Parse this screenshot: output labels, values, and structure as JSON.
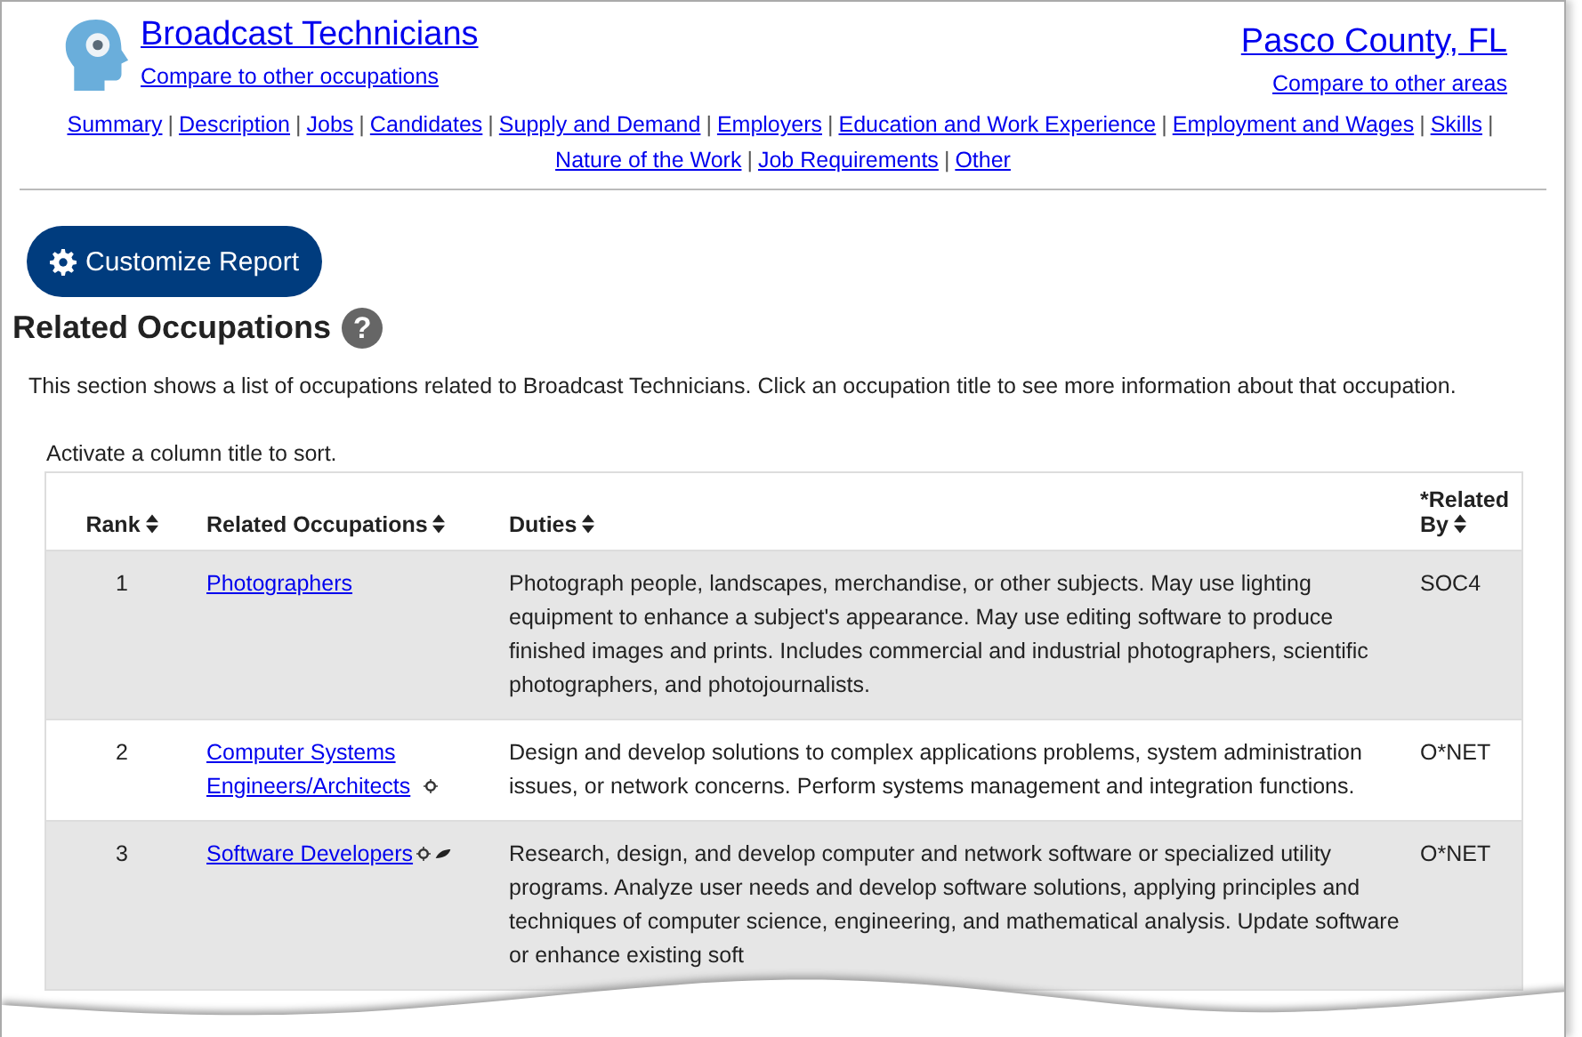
{
  "header": {
    "occupation": "Broadcast Technicians",
    "compare_occupations": "Compare to other occupations",
    "area": "Pasco County, FL",
    "compare_areas": "Compare to other areas"
  },
  "nav": [
    {
      "label": "Summary",
      "separator": "|"
    },
    {
      "label": "Description",
      "separator": "|"
    },
    {
      "label": "Jobs",
      "separator": "|"
    },
    {
      "label": "Candidates",
      "separator": "|"
    },
    {
      "label": "Supply and Demand",
      "separator": "|"
    },
    {
      "label": "Employers",
      "separator": "|"
    },
    {
      "label": "Education and Work Experience",
      "separator": "|"
    },
    {
      "label": "Employment and Wages",
      "separator": "|"
    },
    {
      "label": "Skills",
      "separator": "|"
    },
    {
      "label": "Nature of the Work",
      "separator": "|"
    },
    {
      "label": "Job Requirements",
      "separator": "|"
    },
    {
      "label": "Other"
    }
  ],
  "customize_button": "Customize Report",
  "section": {
    "title": "Related Occupations",
    "help_icon": "?",
    "description": "This section shows a list of occupations related to Broadcast Technicians. Click an occupation title to see more information about that occupation.",
    "sort_hint": "Activate a column title to sort."
  },
  "table": {
    "columns": [
      "Rank",
      "Related Occupations",
      "Duties",
      "*Related By"
    ],
    "rows": [
      {
        "rank": "1",
        "occupation": "Photographers",
        "bright_outlook": false,
        "green": false,
        "duties": "Photograph people, landscapes, merchandise, or other subjects. May use lighting equipment to enhance a subject's appearance. May use editing software to produce finished images and prints. Includes commercial and industrial photographers, scientific photographers, and photojournalists.",
        "related_by": "SOC4"
      },
      {
        "rank": "2",
        "occupation": "Computer Systems Engineers/Architects",
        "bright_outlook": true,
        "green": false,
        "duties": "Design and develop solutions to complex applications problems, system administration issues, or network concerns. Perform systems management and integration functions.",
        "related_by": "O*NET"
      },
      {
        "rank": "3",
        "occupation": "Software Developers",
        "bright_outlook": true,
        "green": true,
        "duties": "Research, design, and develop computer and network software or specialized utility programs. Analyze user needs and develop software solutions, applying principles and techniques of computer science, engineering, and mathematical analysis. Update software or enhance existing soft",
        "related_by": "O*NET"
      }
    ]
  }
}
